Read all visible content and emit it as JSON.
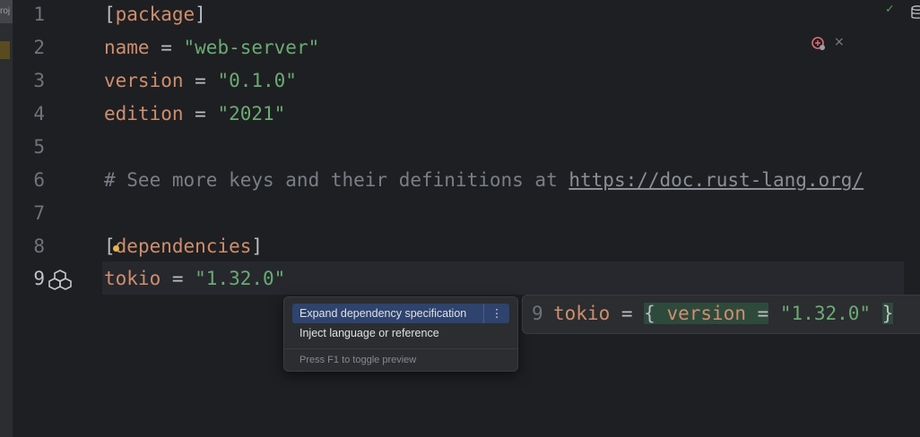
{
  "sidebar": {
    "tab_label": "roj"
  },
  "line_numbers": [
    "1",
    "2",
    "3",
    "4",
    "5",
    "6",
    "7",
    "8",
    "9"
  ],
  "code": {
    "l1": {
      "open": "[",
      "section": "package",
      "close": "]"
    },
    "l2": {
      "key": "name",
      "eq": " = ",
      "value": "\"web-server\""
    },
    "l3": {
      "key": "version",
      "eq": " = ",
      "value": "\"0.1.0\""
    },
    "l4": {
      "key": "edition",
      "eq": " = ",
      "value": "\"2021\""
    },
    "l6": {
      "comment": "# See more keys and their definitions at ",
      "url": "https://doc.rust-lang.org/"
    },
    "l8": {
      "open": "[",
      "section": "dependencies",
      "close": "]"
    },
    "l9": {
      "key": "tokio",
      "eq": " = ",
      "value": "\"1.32.0\""
    }
  },
  "intention_popup": {
    "selected": "Expand dependency specification",
    "more": "⋮",
    "second": "Inject language or reference",
    "footer": "Press F1 to toggle preview"
  },
  "preview": {
    "line_number": "9",
    "key": "tokio",
    "eq": " = ",
    "open_brace": "{",
    "inner_key": " version ",
    "inner_eq": "=",
    "value": " \"1.32.0\" ",
    "close_brace": "}"
  },
  "status": {
    "check": "✓",
    "close": "×"
  },
  "colors": {
    "keyword": "#cf8e6d",
    "string": "#6aab73",
    "selection": "#2e436e",
    "background": "#1e1f22"
  }
}
